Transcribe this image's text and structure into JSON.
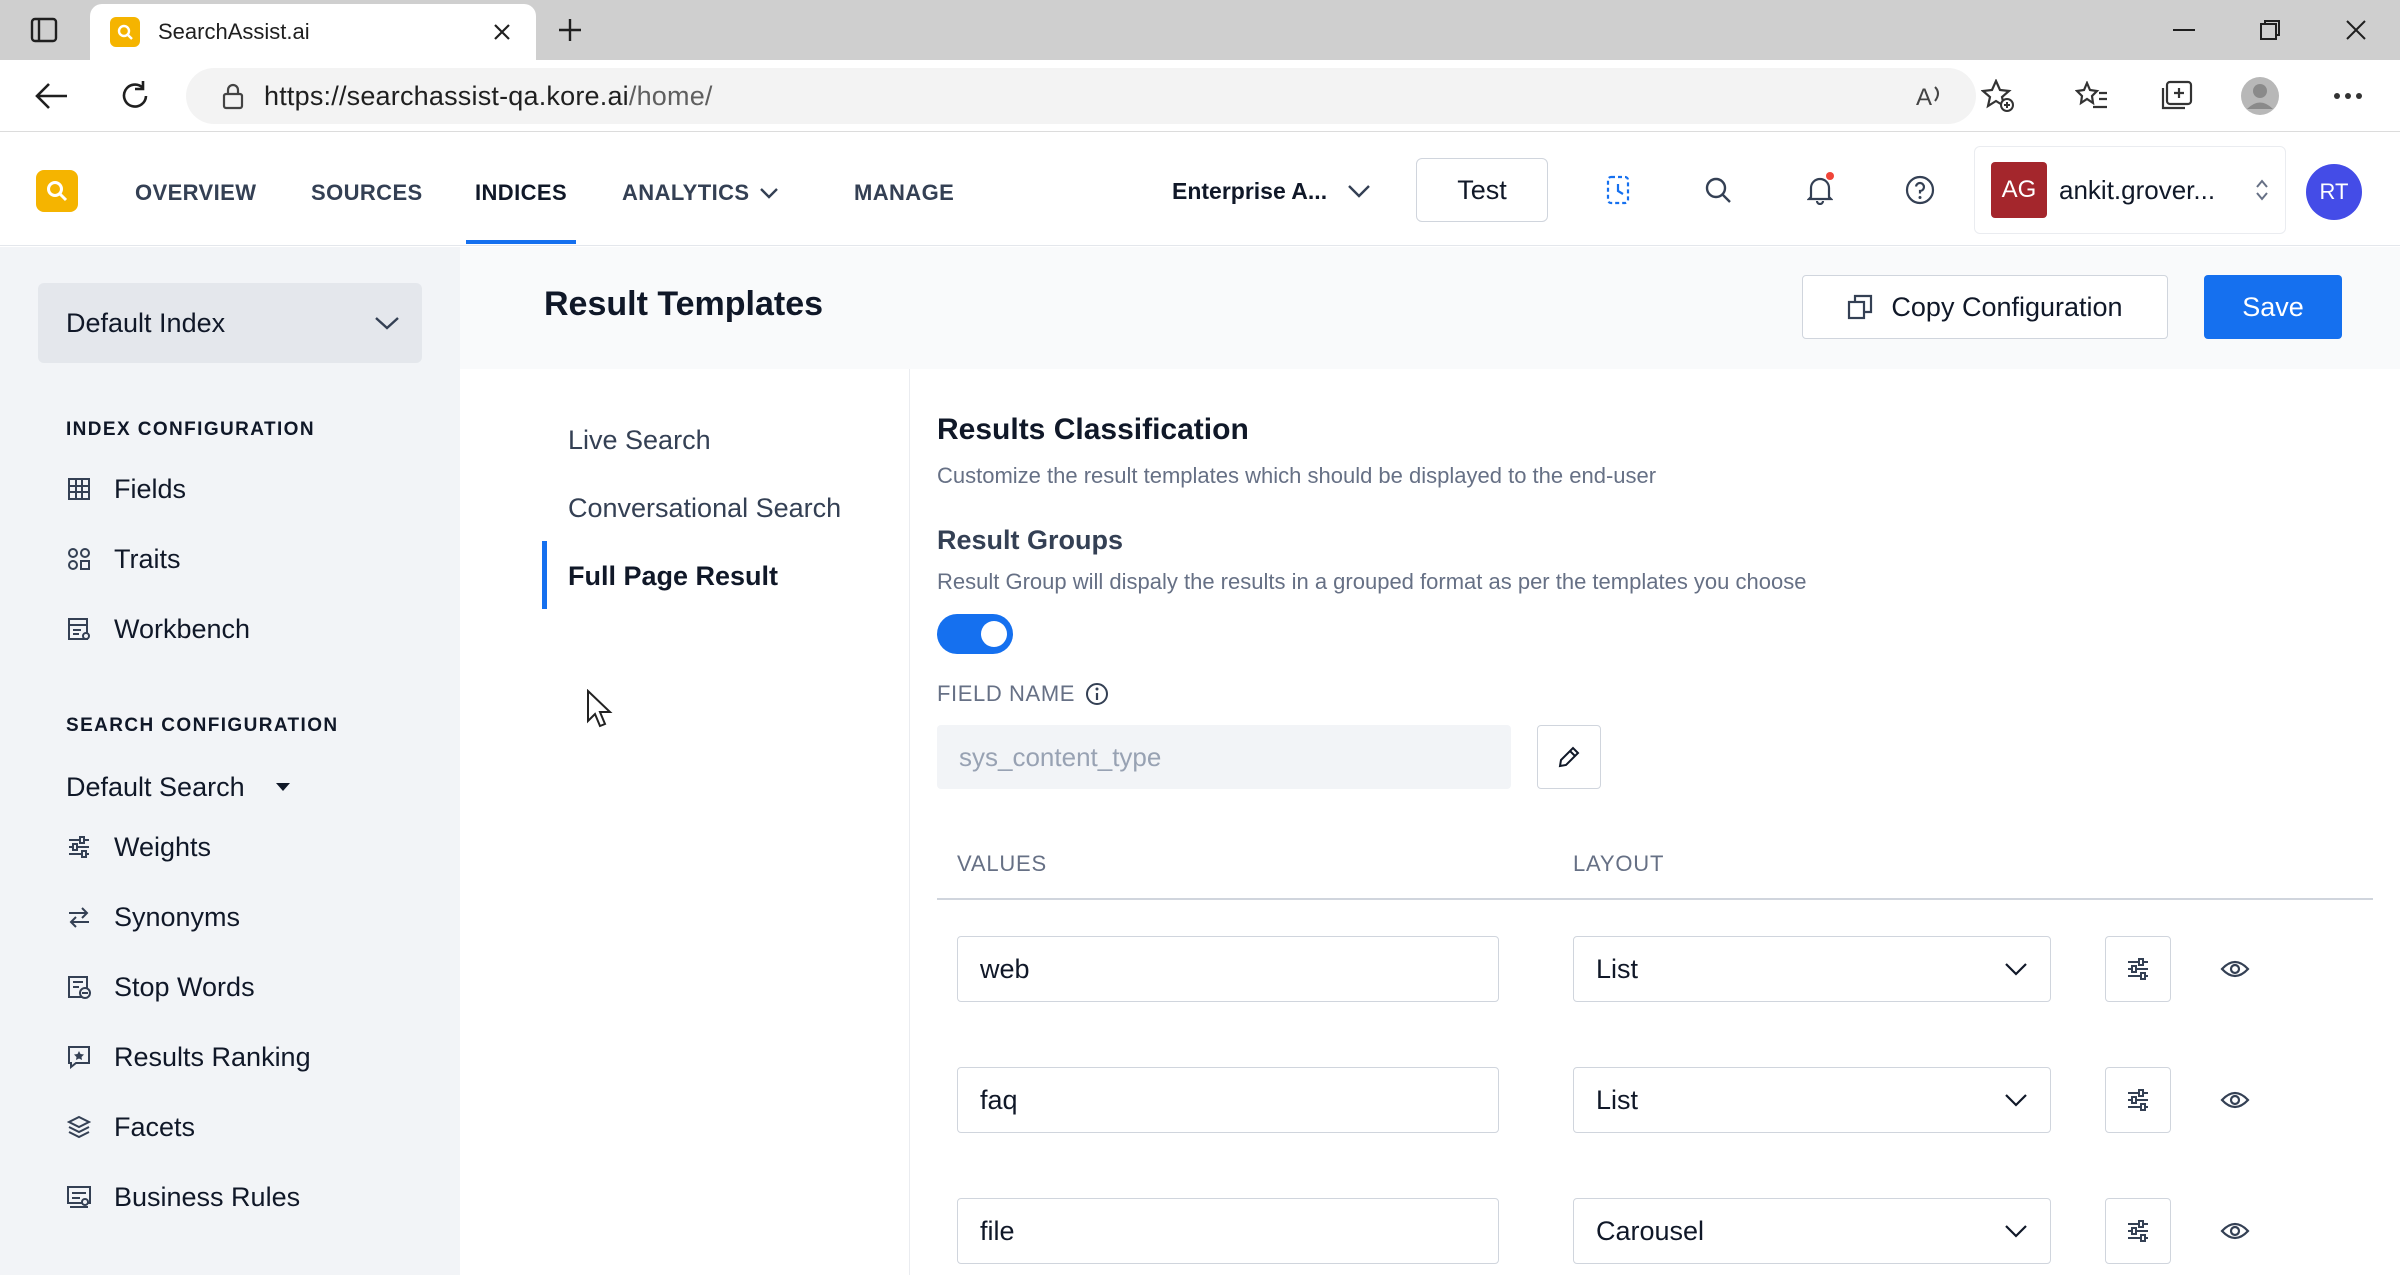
{
  "browser": {
    "tab_title": "SearchAssist.ai",
    "url_base": "https://searchassist-qa.kore.ai",
    "url_path": "/home/"
  },
  "header": {
    "nav": [
      {
        "label": "OVERVIEW"
      },
      {
        "label": "SOURCES"
      },
      {
        "label": "INDICES",
        "active": true
      },
      {
        "label": "ANALYTICS"
      },
      {
        "label": "MANAGE"
      }
    ],
    "workspace": "Enterprise A...",
    "test_label": "Test",
    "user_initials": "AG",
    "user_name": "ankit.grover...",
    "avatar_initials": "RT",
    "accent_color": "#1570ef",
    "logo_color": "#f5b400"
  },
  "sidebar": {
    "index_select": "Default Index",
    "index_config_title": "INDEX CONFIGURATION",
    "index_items": [
      {
        "label": "Fields",
        "icon": "grid-icon"
      },
      {
        "label": "Traits",
        "icon": "traits-icon"
      },
      {
        "label": "Workbench",
        "icon": "workbench-icon"
      }
    ],
    "search_config_title": "SEARCH CONFIGURATION",
    "search_select": "Default Search",
    "search_items": [
      {
        "label": "Weights",
        "icon": "sliders-icon"
      },
      {
        "label": "Synonyms",
        "icon": "swap-arrows-icon"
      },
      {
        "label": "Stop Words",
        "icon": "stop-words-icon"
      },
      {
        "label": "Results Ranking",
        "icon": "ranking-icon"
      },
      {
        "label": "Facets",
        "icon": "layers-icon"
      },
      {
        "label": "Business Rules",
        "icon": "rules-icon"
      }
    ]
  },
  "page": {
    "title": "Result Templates",
    "copy_label": "Copy Configuration",
    "save_label": "Save"
  },
  "subnav": {
    "items": [
      {
        "label": "Live Search"
      },
      {
        "label": "Conversational Search"
      },
      {
        "label": "Full Page Result",
        "active": true
      }
    ]
  },
  "classification": {
    "title": "Results Classification",
    "description": "Customize the result templates which should be displayed to the end-user",
    "groups_title": "Result Groups",
    "groups_description": "Result Group will dispaly the results in a grouped format as per the templates you choose",
    "groups_enabled": true,
    "field_name_label": "FIELD NAME",
    "field_name_value": "sys_content_type",
    "values_header": "VALUES",
    "layout_header": "LAYOUT",
    "rows": [
      {
        "value": "web",
        "layout": "List"
      },
      {
        "value": "faq",
        "layout": "List"
      },
      {
        "value": "file",
        "layout": "Carousel"
      }
    ]
  }
}
